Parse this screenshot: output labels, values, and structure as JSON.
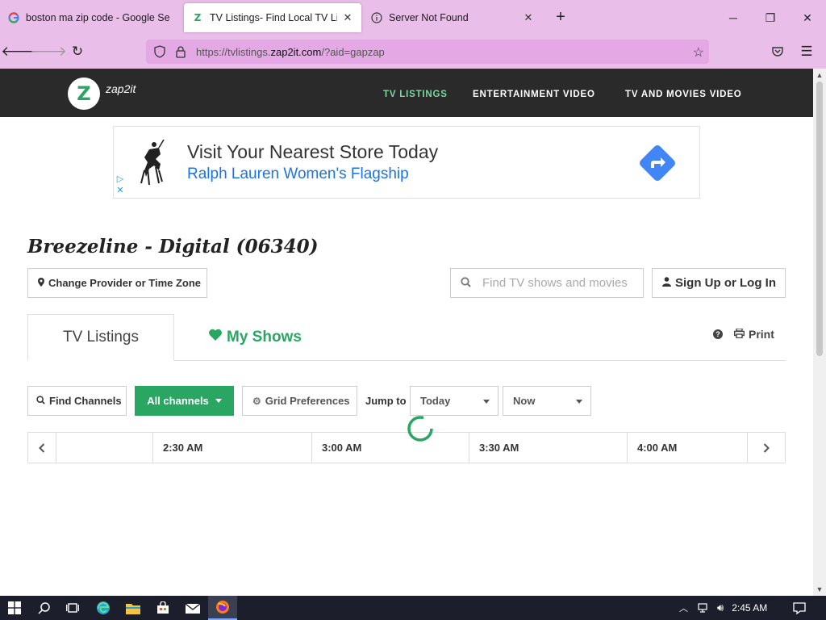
{
  "browser": {
    "tabs": [
      {
        "title": "boston ma zip code - Google Se",
        "favicon": "google-g-icon"
      },
      {
        "title": "TV Listings- Find Local TV Listin",
        "favicon": "zap2it-icon",
        "active": true
      },
      {
        "title": "Server Not Found",
        "favicon": "info-icon"
      }
    ],
    "new_tab": "+",
    "url_prefix": "https://tvlistings.",
    "url_domain": "zap2it.com",
    "url_suffix": "/?aid=gapzap"
  },
  "site": {
    "logo_letter": "Z",
    "logo_text": "zap2it",
    "nav": [
      {
        "label": "TV LISTINGS",
        "active": true,
        "color": "#7ed6a0"
      },
      {
        "label": "ENTERTAINMENT VIDEO"
      },
      {
        "label": "TV AND MOVIES VIDEO"
      }
    ]
  },
  "ad": {
    "headline": "Visit Your Nearest Store Today",
    "subline": "Ralph Lauren Women's Flagship",
    "brand_color": "#1a73e8"
  },
  "listing": {
    "provider_title": "Breezeline - Digital (06340)",
    "change_provider": "Change Provider or Time Zone",
    "search_placeholder": "Find TV shows and movies",
    "signup": "Sign Up or Log In",
    "tab_tv": "TV Listings",
    "tab_my_shows": "My Shows",
    "print": "Print",
    "find_channels": "Find Channels",
    "all_channels": "All channels",
    "grid_preferences": "Grid Preferences",
    "jump_to": "Jump to",
    "day_select": "Today",
    "time_select": "Now",
    "time_slots": [
      "2:30 AM",
      "3:00 AM",
      "3:30 AM",
      "4:00 AM"
    ],
    "accent_color": "#2aa663"
  },
  "taskbar": {
    "clock": "2:45 AM"
  }
}
